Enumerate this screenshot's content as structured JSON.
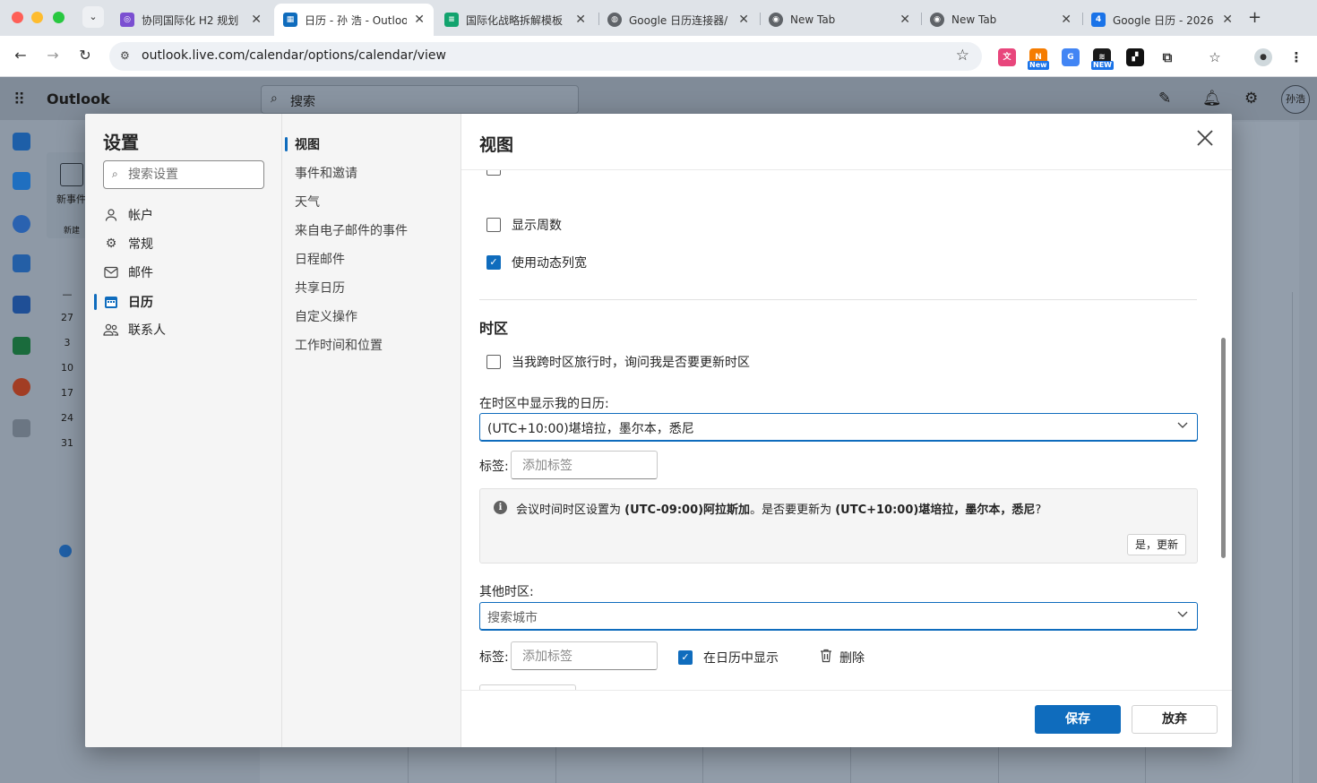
{
  "browser": {
    "tabs": [
      {
        "title": "协同国际化 H2 规划",
        "favicon_color": "#7b4fd1",
        "favicon_icon": "loop-icon"
      },
      {
        "title": "日历 - 孙 浩 - Outlook",
        "favicon_color": "#0f6cbd",
        "favicon_icon": "calendar-icon"
      },
      {
        "title": "国际化战略拆解模板",
        "favicon_color": "#12a36e",
        "favicon_icon": "doc-icon"
      },
      {
        "title": "Google 日历连接器/",
        "favicon_color": "#5f6368",
        "favicon_icon": "globe-icon"
      },
      {
        "title": "New Tab",
        "favicon_color": "#5f6368",
        "favicon_icon": "chrome-icon"
      },
      {
        "title": "New Tab",
        "favicon_color": "#5f6368",
        "favicon_icon": "chrome-icon"
      },
      {
        "title": "Google 日历 - 2026",
        "favicon_color": "#1a73e8",
        "favicon_icon": "google-calendar-icon",
        "favicon_text": "4"
      }
    ],
    "url": "outlook.live.com/calendar/options/calendar/view",
    "extensions": {
      "new_badge_1": "New",
      "new_badge_2": "NEW"
    }
  },
  "outlook": {
    "app_name": "Outlook",
    "search_placeholder": "搜索",
    "avatar_initials": "孙浩",
    "new_event": "新事件",
    "new_group": "新建",
    "mini_calendar_days": [
      "—",
      "27",
      "3",
      "10",
      "17",
      "24",
      "31"
    ]
  },
  "settings": {
    "title": "设置",
    "search_placeholder": "搜索设置",
    "categories": [
      {
        "label": "帐户",
        "icon": "person-icon"
      },
      {
        "label": "常规",
        "icon": "gear-icon"
      },
      {
        "label": "邮件",
        "icon": "mail-icon"
      },
      {
        "label": "日历",
        "icon": "calendar-icon",
        "active": true
      },
      {
        "label": "联系人",
        "icon": "people-icon"
      }
    ],
    "subcategories": [
      {
        "label": "视图",
        "active": true
      },
      {
        "label": "事件和邀请"
      },
      {
        "label": "天气"
      },
      {
        "label": "来自电子邮件的事件"
      },
      {
        "label": "日程邮件"
      },
      {
        "label": "共享日历"
      },
      {
        "label": "自定义操作"
      },
      {
        "label": "工作时间和位置"
      }
    ]
  },
  "view_pane": {
    "title": "视图",
    "options": {
      "show_week_numbers": {
        "label": "显示周数",
        "checked": false
      },
      "dynamic_column_width": {
        "label": "使用动态列宽",
        "checked": true
      }
    },
    "timezone": {
      "section_title": "时区",
      "ask_update": {
        "label": "当我跨时区旅行时，询问我是否要更新时区",
        "checked": false
      },
      "display_label": "在时区中显示我的日历:",
      "display_value": "(UTC+10:00)堪培拉，墨尔本，悉尼",
      "tag_label": "标签:",
      "tag_placeholder": "添加标签",
      "info": {
        "prefix": "会议时间时区设置为 ",
        "current": "(UTC-09:00)阿拉斯加",
        "middle": "。是否要更新为 ",
        "suggested": "(UTC+10:00)堪培拉，墨尔本，悉尼",
        "suffix": "?",
        "button": "是，更新"
      },
      "other_label": "其他时区:",
      "other_placeholder": "搜索城市",
      "other_tag_label": "标签:",
      "other_tag_placeholder": "添加标签",
      "show_in_calendar": {
        "label": "在日历中显示",
        "checked": true
      },
      "delete_label": "删除"
    },
    "footer": {
      "save": "保存",
      "discard": "放弃"
    }
  }
}
